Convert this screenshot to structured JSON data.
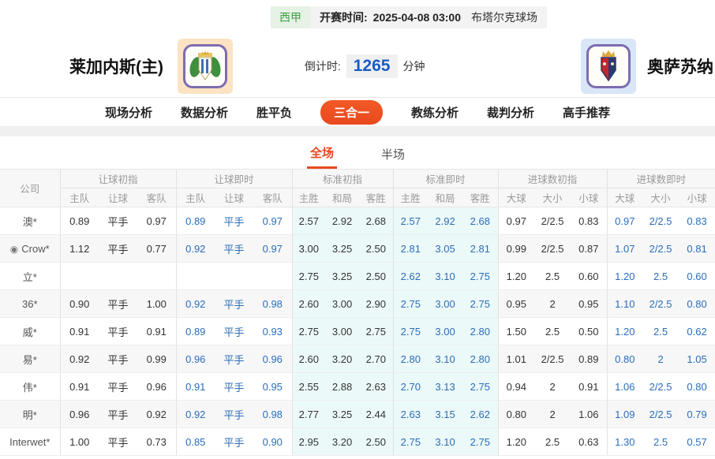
{
  "colors": {
    "accent": "#e8491f",
    "odds_blue": "#2b6db8",
    "league_green": "#3f9d44",
    "league_green_bg": "#e5f2e5",
    "cyan_bg": "#ecf9f9",
    "countdown_blue": "#1b5ac6",
    "home_logo_bg": "#fbe3c3",
    "away_logo_bg": "#d9e6f7",
    "logo_border": "#7d6cb0"
  },
  "header": {
    "league": "西甲",
    "match_time_label": "开赛时间:",
    "match_time": "2025-04-08 03:00",
    "venue": "布塔尔克球场",
    "home_team": "莱加内斯(主)",
    "away_team": "奥萨苏纳",
    "countdown_label": "倒计时:",
    "countdown_value": "1265",
    "countdown_unit": "分钟"
  },
  "nav": {
    "tabs": [
      {
        "label": "现场分析",
        "active": false
      },
      {
        "label": "数据分析",
        "active": false
      },
      {
        "label": "胜平负",
        "active": false
      },
      {
        "label": "三合一",
        "active": true
      },
      {
        "label": "教练分析",
        "active": false
      },
      {
        "label": "裁判分析",
        "active": false
      },
      {
        "label": "高手推荐",
        "active": false
      }
    ]
  },
  "subtabs": [
    {
      "label": "全场",
      "active": true
    },
    {
      "label": "半场",
      "active": false
    }
  ],
  "table": {
    "company_header": "公司",
    "groups": [
      {
        "label": "让球初指",
        "cols": [
          "主队",
          "让球",
          "客队"
        ]
      },
      {
        "label": "让球即时",
        "cols": [
          "主队",
          "让球",
          "客队"
        ]
      },
      {
        "label": "标准初指",
        "cols": [
          "主胜",
          "和局",
          "客胜"
        ]
      },
      {
        "label": "标准即时",
        "cols": [
          "主胜",
          "和局",
          "客胜"
        ]
      },
      {
        "label": "进球数初指",
        "cols": [
          "大球",
          "大小",
          "小球"
        ]
      },
      {
        "label": "进球数即时",
        "cols": [
          "大球",
          "大小",
          "小球"
        ]
      }
    ],
    "rows": [
      {
        "company": "澳*",
        "icon": false,
        "cells": [
          "0.89",
          "平手",
          "0.97",
          "0.89",
          "平手",
          "0.97",
          "2.57",
          "2.92",
          "2.68",
          "2.57",
          "2.92",
          "2.68",
          "0.97",
          "2/2.5",
          "0.83",
          "0.97",
          "2/2.5",
          "0.83"
        ]
      },
      {
        "company": "Crow*",
        "icon": true,
        "cells": [
          "1.12",
          "平手",
          "0.77",
          "0.92",
          "平手",
          "0.97",
          "3.00",
          "3.25",
          "2.50",
          "2.81",
          "3.05",
          "2.81",
          "0.99",
          "2/2.5",
          "0.87",
          "1.07",
          "2/2.5",
          "0.81"
        ]
      },
      {
        "company": "立*",
        "icon": false,
        "cells": [
          "",
          "",
          "",
          "",
          "",
          "",
          "2.75",
          "3.25",
          "2.50",
          "2.62",
          "3.10",
          "2.75",
          "1.20",
          "2.5",
          "0.60",
          "1.20",
          "2.5",
          "0.60"
        ]
      },
      {
        "company": "36*",
        "icon": false,
        "cells": [
          "0.90",
          "平手",
          "1.00",
          "0.92",
          "平手",
          "0.98",
          "2.60",
          "3.00",
          "2.90",
          "2.75",
          "3.00",
          "2.75",
          "0.95",
          "2",
          "0.95",
          "1.10",
          "2/2.5",
          "0.80"
        ]
      },
      {
        "company": "威*",
        "icon": false,
        "cells": [
          "0.91",
          "平手",
          "0.91",
          "0.89",
          "平手",
          "0.93",
          "2.75",
          "3.00",
          "2.75",
          "2.75",
          "3.00",
          "2.80",
          "1.50",
          "2.5",
          "0.50",
          "1.20",
          "2.5",
          "0.62"
        ]
      },
      {
        "company": "易*",
        "icon": false,
        "cells": [
          "0.92",
          "平手",
          "0.99",
          "0.96",
          "平手",
          "0.96",
          "2.60",
          "3.20",
          "2.70",
          "2.80",
          "3.10",
          "2.80",
          "1.01",
          "2/2.5",
          "0.89",
          "0.80",
          "2",
          "1.05"
        ]
      },
      {
        "company": "伟*",
        "icon": false,
        "cells": [
          "0.91",
          "平手",
          "0.96",
          "0.91",
          "平手",
          "0.95",
          "2.55",
          "2.88",
          "2.63",
          "2.70",
          "3.13",
          "2.75",
          "0.94",
          "2",
          "0.91",
          "1.06",
          "2/2.5",
          "0.80"
        ]
      },
      {
        "company": "明*",
        "icon": false,
        "cells": [
          "0.96",
          "平手",
          "0.92",
          "0.92",
          "平手",
          "0.98",
          "2.77",
          "3.25",
          "2.44",
          "2.63",
          "3.15",
          "2.62",
          "0.80",
          "2",
          "1.06",
          "1.09",
          "2/2.5",
          "0.79"
        ]
      },
      {
        "company": "Interwet*",
        "icon": false,
        "cells": [
          "1.00",
          "平手",
          "0.73",
          "0.85",
          "平手",
          "0.90",
          "2.95",
          "3.20",
          "2.50",
          "2.75",
          "3.10",
          "2.75",
          "1.20",
          "2.5",
          "0.63",
          "1.30",
          "2.5",
          "0.57"
        ]
      }
    ]
  }
}
